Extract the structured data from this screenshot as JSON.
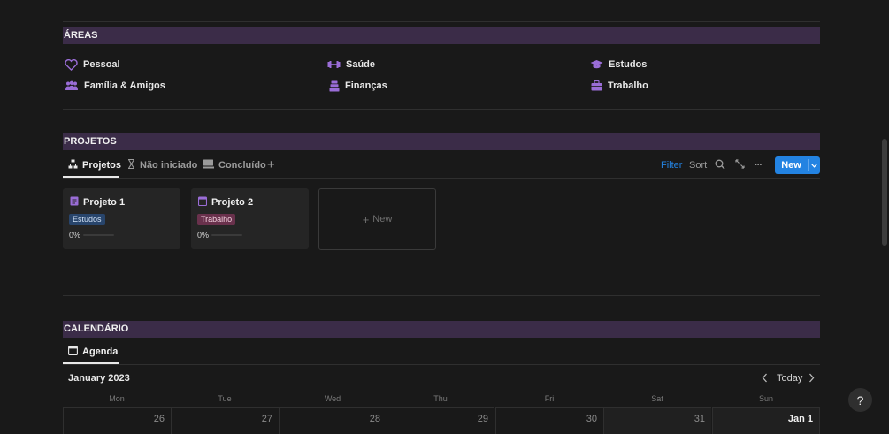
{
  "colors": {
    "accent": "#2383e2",
    "section_band": "#3b2c48",
    "icon_purple": "#9a6dd7",
    "tag_estudos_bg": "#28456c",
    "tag_trabalho_bg": "#69314c"
  },
  "areas": {
    "title": "ÁREAS",
    "items": [
      {
        "label": "Pessoal",
        "icon": "heart-icon"
      },
      {
        "label": "Saúde",
        "icon": "dumbbell-icon"
      },
      {
        "label": "Estudos",
        "icon": "graduation-cap-icon"
      },
      {
        "label": "Família & Amigos",
        "icon": "people-icon"
      },
      {
        "label": "Finanças",
        "icon": "money-stack-icon"
      },
      {
        "label": "Trabalho",
        "icon": "briefcase-icon"
      }
    ]
  },
  "projects": {
    "title": "PROJETOS",
    "tabs": [
      {
        "label": "Projetos",
        "icon": "hierarchy-icon",
        "active": true
      },
      {
        "label": "Não iniciado",
        "icon": "hourglass-icon",
        "active": false
      },
      {
        "label": "Concluído",
        "icon": "computer-icon",
        "active": false
      }
    ],
    "add_tab": "+",
    "toolbar": {
      "filter": "Filter",
      "sort": "Sort",
      "more": "···",
      "new": "New"
    },
    "cards": [
      {
        "title": "Projeto 1",
        "tag": "Estudos",
        "progress_label": "0%",
        "progress": 0
      },
      {
        "title": "Projeto 2",
        "tag": "Trabalho",
        "progress_label": "0%",
        "progress": 0
      }
    ],
    "new_card": "New"
  },
  "calendar": {
    "title": "CALENDÁRIO",
    "tab": "Agenda",
    "month": "January 2023",
    "today": "Today",
    "weekdays": [
      "Mon",
      "Tue",
      "Wed",
      "Thu",
      "Fri",
      "Sat",
      "Sun"
    ],
    "days": [
      "26",
      "27",
      "28",
      "29",
      "30",
      "31",
      "Jan 1"
    ]
  },
  "help": "?"
}
